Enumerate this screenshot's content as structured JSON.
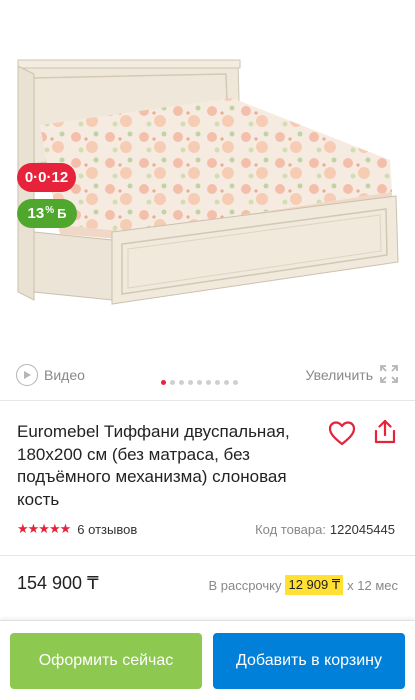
{
  "gallery": {
    "installment_badge": "0·0·12",
    "bonus_badge_value": "13",
    "bonus_badge_percent": "%",
    "bonus_badge_icon": "Б",
    "video_label": "Видео",
    "zoom_label": "Увеличить",
    "image_count": 9,
    "active_image_index": 0
  },
  "product": {
    "title": "Euromebel Тиффани двуспальная, 180x200 см (без матраса, без подъёмного механизма) слоновая кость",
    "rating_stars": "★★★★★",
    "rating_value": 5,
    "reviews": "6 отзывов",
    "code_label": "Код товара:",
    "code_value": "122045445",
    "price": "154 900 ₸",
    "installment_label": "В рассрочку",
    "installment_amount": "12 909 ₸",
    "installment_term": "x 12 мес"
  },
  "actions": {
    "buy_now": "Оформить сейчас",
    "add_to_cart": "Добавить в корзину"
  },
  "colors": {
    "accent_red": "#e6233b",
    "bonus_green": "#4fa82d",
    "buy_now_green": "#8dc850",
    "cart_blue": "#0080d9",
    "highlight_yellow": "#ffe033"
  },
  "icons": [
    "play-icon",
    "zoom-icon",
    "heart-icon",
    "share-icon",
    "star-icon"
  ]
}
